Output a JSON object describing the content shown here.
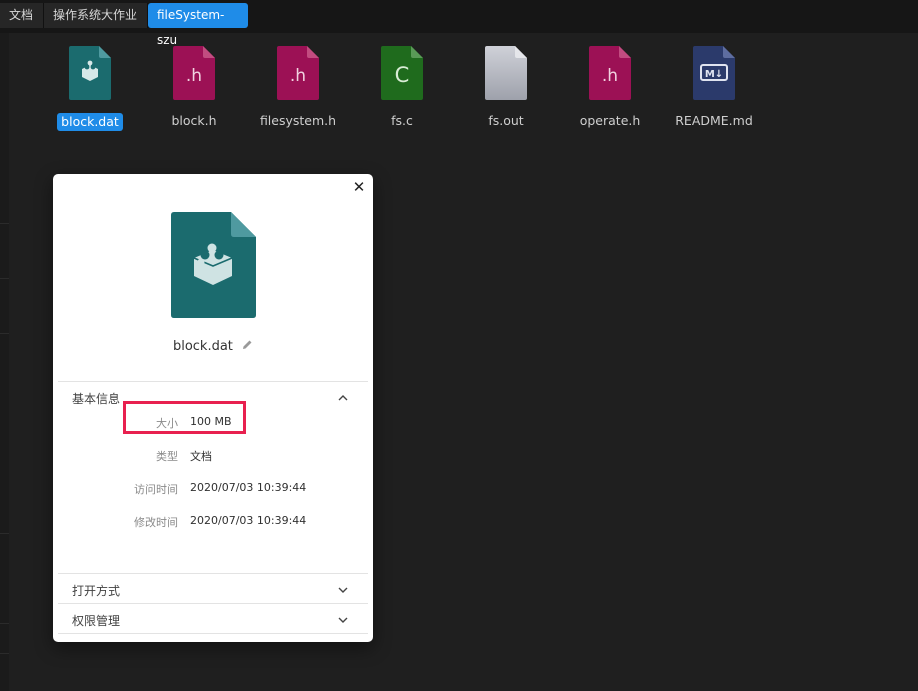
{
  "breadcrumbs": [
    "文档",
    "操作系统大作业",
    "fileSystem-szu"
  ],
  "files": [
    {
      "name": "block.dat",
      "icon": "database-file-icon",
      "color": "#1b6b6e",
      "glyph": "",
      "selected": true
    },
    {
      "name": "block.h",
      "icon": "header-file-icon",
      "color": "#9c1155",
      "glyph": ".h",
      "selected": false
    },
    {
      "name": "filesystem.h",
      "icon": "header-file-icon",
      "color": "#9c1155",
      "glyph": ".h",
      "selected": false
    },
    {
      "name": "fs.c",
      "icon": "c-source-file-icon",
      "color": "#1f6b1d",
      "glyph": "C",
      "selected": false
    },
    {
      "name": "fs.out",
      "icon": "binary-file-icon",
      "color": "#b3b6bf",
      "glyph": "",
      "selected": false
    },
    {
      "name": "operate.h",
      "icon": "header-file-icon",
      "color": "#9c1155",
      "glyph": ".h",
      "selected": false
    },
    {
      "name": "README.md",
      "icon": "markdown-file-icon",
      "color": "#2b3a6b",
      "glyph": "M↓",
      "selected": false
    }
  ],
  "dialog": {
    "file_name": "block.dat",
    "basic_info": {
      "title": "基本信息",
      "rows": [
        {
          "label": "大小",
          "value": "100 MB"
        },
        {
          "label": "类型",
          "value": "文档"
        },
        {
          "label": "访问时间",
          "value": "2020/07/03 10:39:44"
        },
        {
          "label": "修改时间",
          "value": "2020/07/03 10:39:44"
        }
      ]
    },
    "open_with": {
      "title": "打开方式"
    },
    "permissions": {
      "title": "权限管理"
    }
  },
  "colors": {
    "accent": "#1f8ce8",
    "highlight": "#e8204f",
    "background": "#1f1f1f"
  }
}
